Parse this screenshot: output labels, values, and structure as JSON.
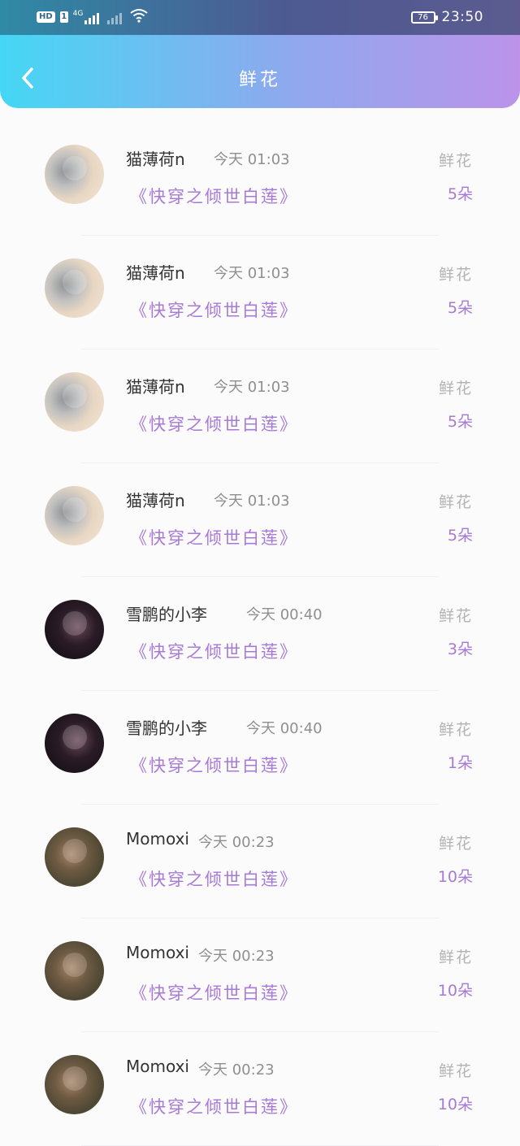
{
  "status_bar": {
    "hd": "HD",
    "sim": "1",
    "net": "4G",
    "battery": "76",
    "time": "23:50"
  },
  "header": {
    "title": "鲜花",
    "back_icon": "chevron-left-icon"
  },
  "colors": {
    "accent_purple": "#a77ad6",
    "header_start": "#45d7f5",
    "header_end": "#bb93e9",
    "muted_text": "#8f8f8f"
  },
  "gift_label": "鲜花",
  "items": [
    {
      "user": "猫薄荷n",
      "time": "今天 01:03",
      "book": "《快穿之倾世白莲》",
      "count": "5朵"
    },
    {
      "user": "猫薄荷n",
      "time": "今天 01:03",
      "book": "《快穿之倾世白莲》",
      "count": "5朵"
    },
    {
      "user": "猫薄荷n",
      "time": "今天 01:03",
      "book": "《快穿之倾世白莲》",
      "count": "5朵"
    },
    {
      "user": "猫薄荷n",
      "time": "今天 01:03",
      "book": "《快穿之倾世白莲》",
      "count": "5朵"
    },
    {
      "user": "雪鹏的小李",
      "time": "今天 00:40",
      "book": "《快穿之倾世白莲》",
      "count": "3朵"
    },
    {
      "user": "雪鹏的小李",
      "time": "今天 00:40",
      "book": "《快穿之倾世白莲》",
      "count": "1朵"
    },
    {
      "user": "Momoxi",
      "time": "今天 00:23",
      "book": "《快穿之倾世白莲》",
      "count": "10朵"
    },
    {
      "user": "Momoxi",
      "time": "今天 00:23",
      "book": "《快穿之倾世白莲》",
      "count": "10朵"
    },
    {
      "user": "Momoxi",
      "time": "今天 00:23",
      "book": "《快穿之倾世白莲》",
      "count": "10朵"
    }
  ]
}
